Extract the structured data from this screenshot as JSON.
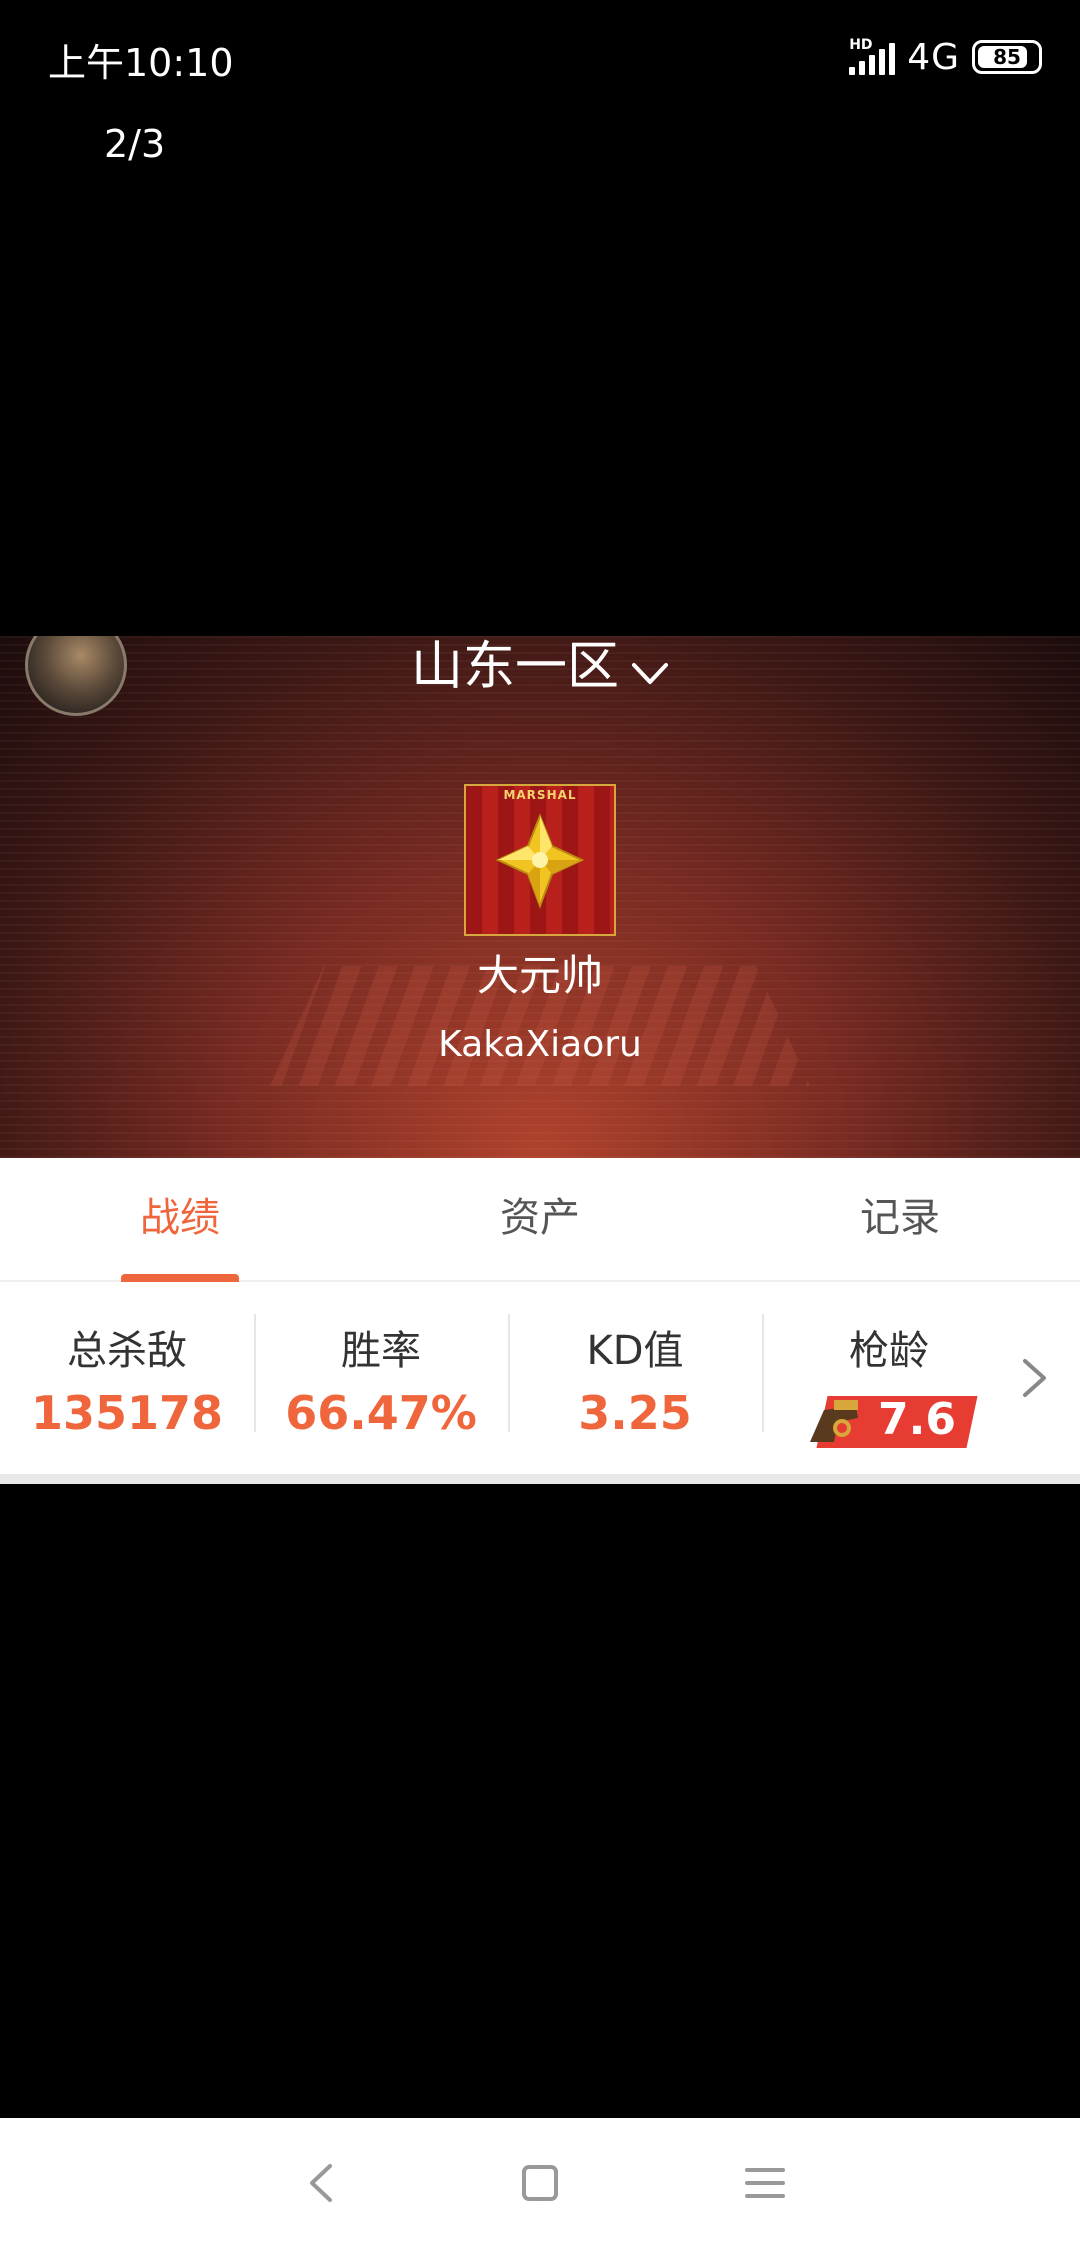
{
  "status_bar": {
    "time": "上午10:10",
    "hd": "HD",
    "network": "4G",
    "battery": "85",
    "battery_level": 0.85
  },
  "page_counter": "2/3",
  "profile": {
    "server": "山东一区",
    "badge_text": "MARSHAL",
    "rank": "大元帅",
    "player_name": "KakaXiaoru"
  },
  "tabs": [
    {
      "label": "战绩",
      "active": true
    },
    {
      "label": "资产",
      "active": false
    },
    {
      "label": "记录",
      "active": false
    }
  ],
  "stats": [
    {
      "label": "总杀敌",
      "value": "135178"
    },
    {
      "label": "胜率",
      "value": "66.47%"
    },
    {
      "label": "KD值",
      "value": "3.25"
    },
    {
      "label": "枪龄",
      "value": "7.6"
    }
  ],
  "colors": {
    "accent": "#f0663c",
    "badge_red": "#b8201c",
    "badge_gold": "#f3d36b"
  },
  "icons": {
    "more": "chevron-right-icon",
    "back": "back-icon",
    "home": "home-icon",
    "menu": "menu-icon"
  }
}
